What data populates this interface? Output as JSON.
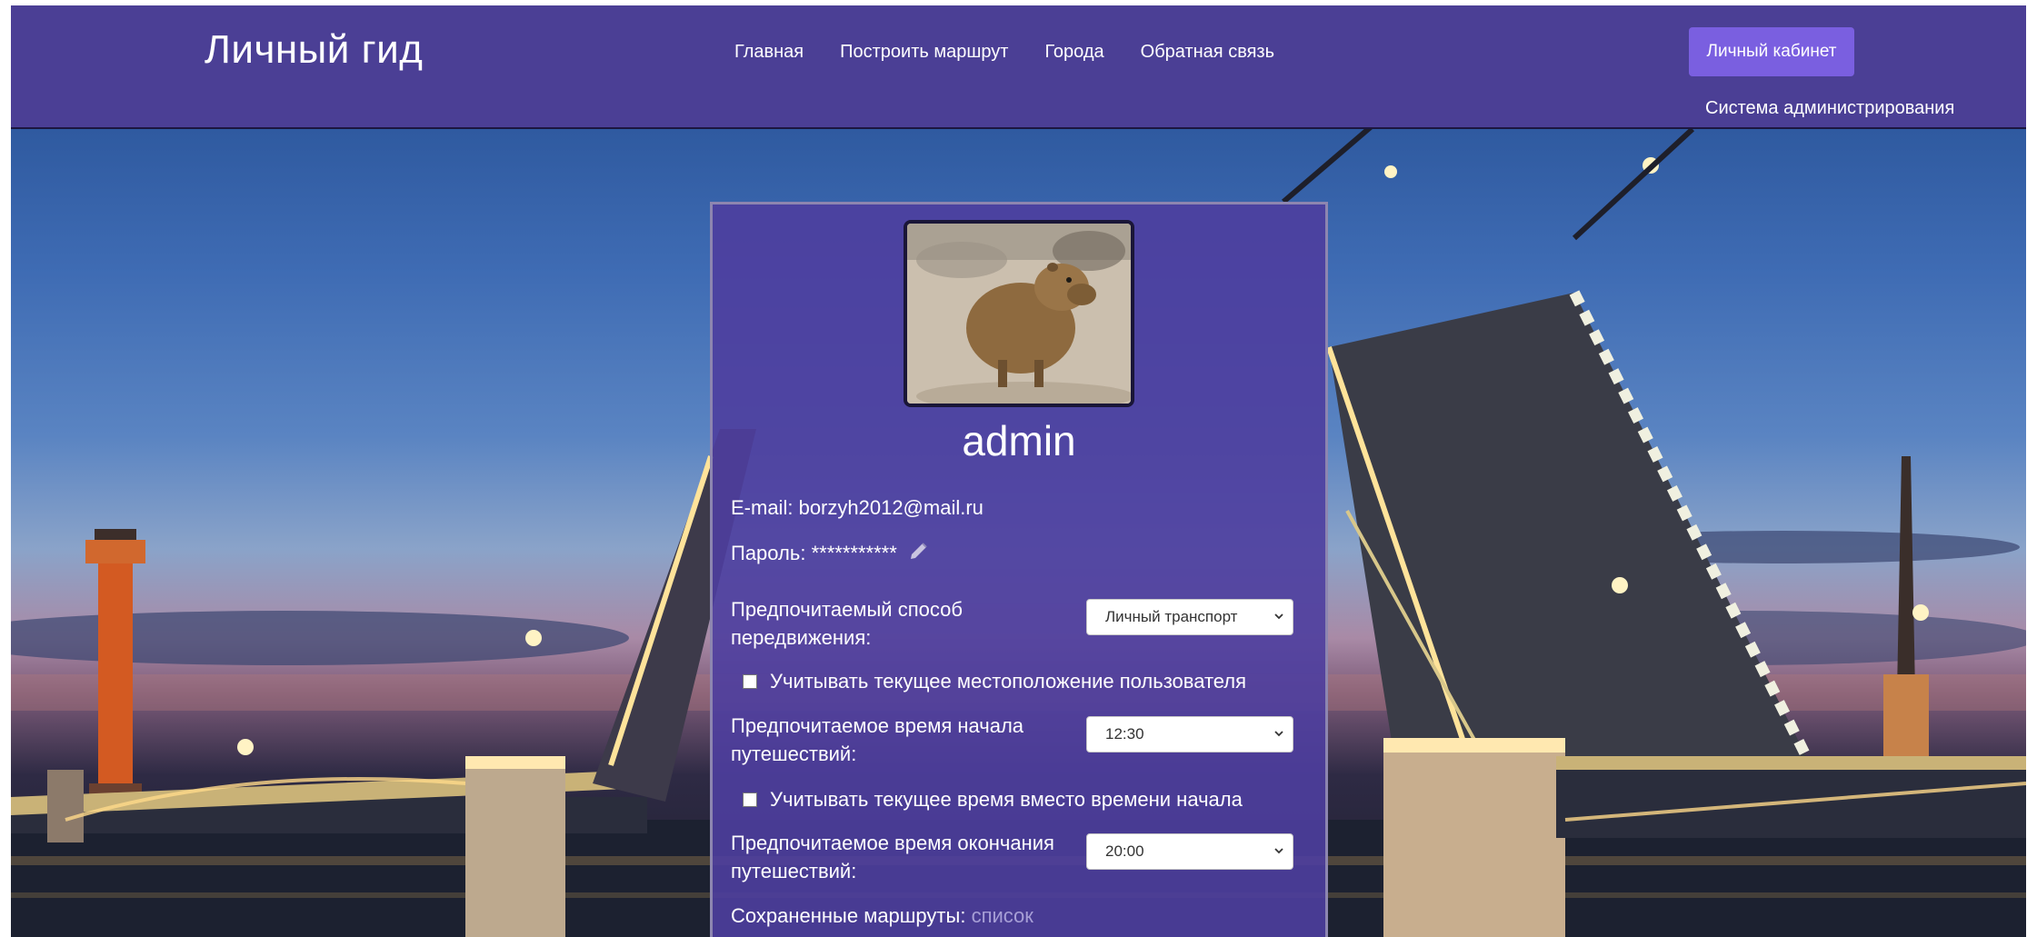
{
  "header": {
    "brand": "Личный гид",
    "nav": [
      {
        "label": "Главная"
      },
      {
        "label": "Построить маршрут"
      },
      {
        "label": "Города"
      },
      {
        "label": "Обратная связь"
      }
    ],
    "cabinet_button": "Личный кабинет",
    "admin_link": "Система администрирования"
  },
  "profile": {
    "username": "admin",
    "email_label": "E-mail:",
    "email_value": "borzyh2012@mail.ru",
    "password_label": "Пароль:",
    "password_value": "***********",
    "transport_label": "Предпочитаемый способ передвижения:",
    "transport_value": "Личный транспорт",
    "use_location_label": "Учитывать текущее местоположение пользователя",
    "start_time_label": "Предпочитаемое время начала путешествий:",
    "start_time_value": "12:30",
    "use_current_time_label": "Учитывать текущее время вместо времени начала",
    "end_time_label": "Предпочитаемое время окончания путешествий:",
    "end_time_value": "20:00",
    "saved_routes_label": "Сохраненные маршруты:",
    "saved_routes_link": "список"
  },
  "colors": {
    "header_bg": "#4b3f95",
    "accent_button": "#7a5fe0",
    "card_bg": "#4e3e9e"
  },
  "icons": {
    "edit": "pencil-icon",
    "dropdown": "chevron-down-icon"
  }
}
